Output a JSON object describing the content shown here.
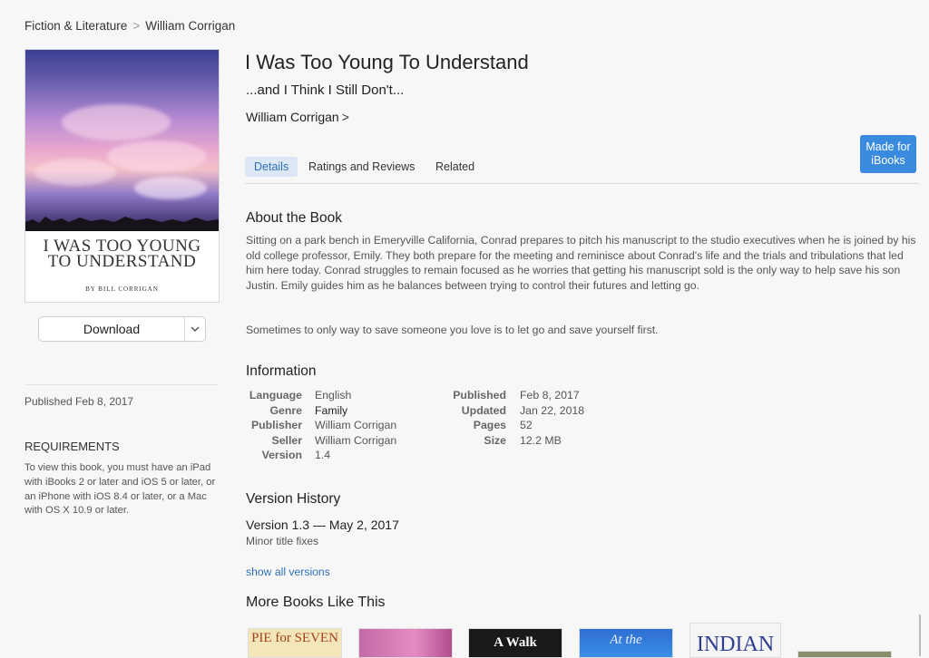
{
  "breadcrumb": {
    "category": "Fiction & Literature",
    "separator": ">",
    "author": "William Corrigan"
  },
  "cover": {
    "title_line1": "I WAS TOO YOUNG",
    "title_line2": "TO UNDERSTAND",
    "byline": "BY BILL CORRIGAN"
  },
  "download": {
    "label": "Download",
    "menu_icon": "chevron-down-icon"
  },
  "sidebar": {
    "published": "Published Feb 8, 2017",
    "requirements_heading": "REQUIREMENTS",
    "requirements_text": "To view this book, you must have an iPad with iBooks 2 or later and iOS 5 or later, or an iPhone with iOS 8.4 or later, or a Mac with OS X 10.9 or later."
  },
  "book": {
    "title": "I Was Too Young To Understand",
    "subtitle": "...and I Think I Still Don't...",
    "author": "William Corrigan",
    "author_chevron": ">",
    "badge_line1": "Made for",
    "badge_line2": "iBooks"
  },
  "tabs": [
    {
      "label": "Details"
    },
    {
      "label": "Ratings and Reviews"
    },
    {
      "label": "Related"
    }
  ],
  "about": {
    "heading": "About the Book",
    "paragraph1": "Sitting on a park bench in Emeryville California, Conrad prepares to pitch his manuscript to the studio executives when he is joined by his old college professor, Emily.  They both prepare for the meeting and reminisce about Conrad's life and the trials and tribulations that led him here today.  Conrad struggles to remain focused as he worries that getting his manuscript sold is the only way to help save his son Justin.  Emily guides him as he balances between trying to control their futures and letting go.",
    "paragraph2": "Sometimes to only way to save someone you love is to let go and save yourself first."
  },
  "information": {
    "heading": "Information",
    "left": [
      {
        "key": "Language",
        "value": "English"
      },
      {
        "key": "Genre",
        "value": "Family"
      },
      {
        "key": "Publisher",
        "value": "William Corrigan"
      },
      {
        "key": "Seller",
        "value": "William Corrigan"
      },
      {
        "key": "Version",
        "value": "1.4"
      }
    ],
    "right": [
      {
        "key": "Published",
        "value": "Feb 8, 2017"
      },
      {
        "key": "Updated",
        "value": "Jan 22, 2018"
      },
      {
        "key": "Pages",
        "value": "52"
      },
      {
        "key": "Size",
        "value": "12.2 MB"
      }
    ]
  },
  "version_history": {
    "heading": "Version History",
    "latest_title": "Version 1.3 — May 2, 2017",
    "latest_note": "Minor title fixes",
    "show_all": "show all versions"
  },
  "more_books": {
    "heading": "More Books Like This",
    "items": [
      {
        "text": "PIE for SEVEN"
      },
      {
        "text": ""
      },
      {
        "text": "A Walk"
      },
      {
        "text": "At the"
      },
      {
        "text": "INDIAN"
      },
      {
        "text": ""
      }
    ]
  }
}
